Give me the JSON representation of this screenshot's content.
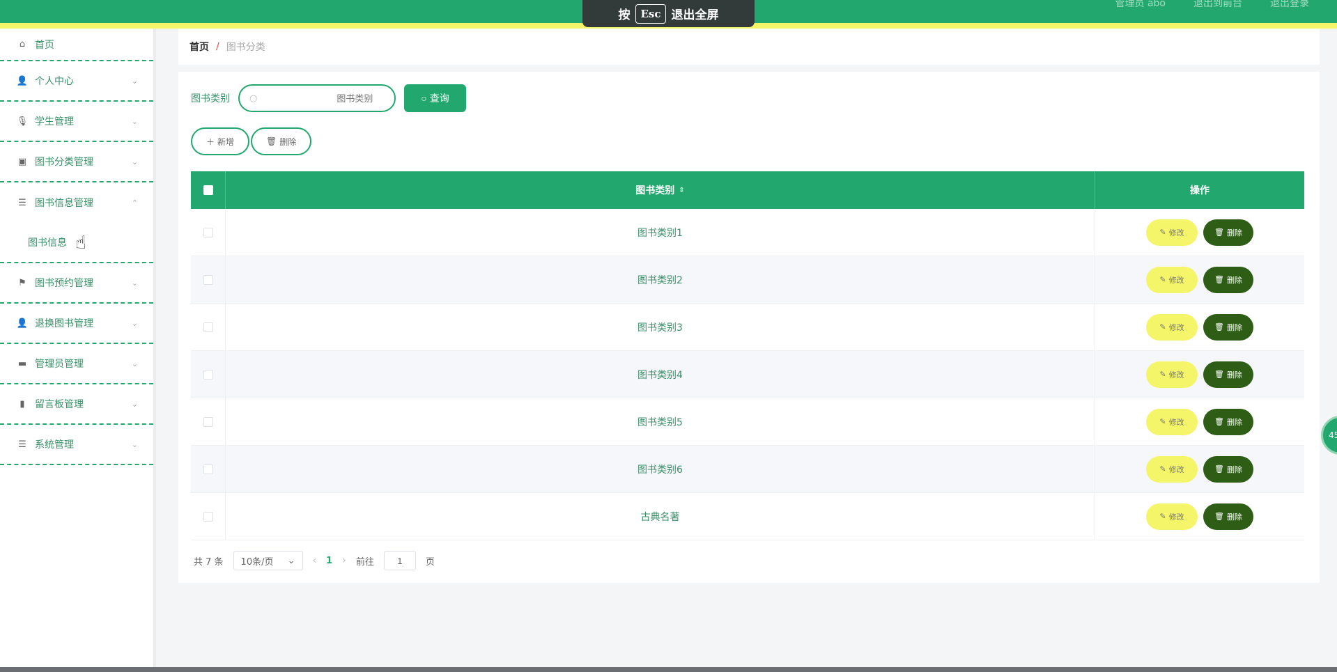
{
  "topbar": {
    "links": [
      "管理员 abo",
      "退出到前台",
      "退出登录"
    ],
    "esc_tip": {
      "prefix": "按",
      "key": "Esc",
      "suffix": "退出全屏"
    }
  },
  "sidebar": {
    "items": [
      {
        "label": "首页",
        "icon": "home-icon",
        "glyph": "⌂",
        "expandable": false
      },
      {
        "label": "个人中心",
        "icon": "user-icon",
        "glyph": "👤",
        "expandable": true
      },
      {
        "label": "学生管理",
        "icon": "microphone-icon",
        "glyph": "🎙",
        "expandable": true
      },
      {
        "label": "图书分类管理",
        "icon": "chart-square-icon",
        "glyph": "▣",
        "expandable": true
      },
      {
        "label": "图书信息管理",
        "icon": "list-icon",
        "glyph": "☰",
        "expandable": true,
        "expanded": true
      },
      {
        "label": "图书预约管理",
        "icon": "flag-icon",
        "glyph": "⚑",
        "expandable": true
      },
      {
        "label": "退换图书管理",
        "icon": "person-icon",
        "glyph": "👤",
        "expandable": true
      },
      {
        "label": "管理员管理",
        "icon": "monitor-icon",
        "glyph": "▬",
        "expandable": true
      },
      {
        "label": "留言板管理",
        "icon": "bar-chart-icon",
        "glyph": "▮",
        "expandable": true
      },
      {
        "label": "系统管理",
        "icon": "list-icon",
        "glyph": "☰",
        "expandable": true
      }
    ],
    "submenu": {
      "label": "图书信息"
    }
  },
  "breadcrumb": {
    "home": "首页",
    "separator": "/",
    "current": "图书分类"
  },
  "search": {
    "label": "图书类别",
    "placeholder": "图书类别",
    "button": "查询"
  },
  "actions": {
    "add": "新增",
    "delete": "删除"
  },
  "table": {
    "headers": {
      "name": "图书类别",
      "ops": "操作"
    },
    "rows": [
      {
        "name": "图书类别1"
      },
      {
        "name": "图书类别2"
      },
      {
        "name": "图书类别3"
      },
      {
        "name": "图书类别4"
      },
      {
        "name": "图书类别5"
      },
      {
        "name": "图书类别6"
      },
      {
        "name": "古典名著"
      }
    ],
    "edit_label": "修改",
    "delete_label": "删除"
  },
  "pagination": {
    "total": "共 7 条",
    "page_size": "10条/页",
    "current_page": "1",
    "goto_prefix": "前往",
    "goto_value": "1",
    "goto_suffix": "页"
  },
  "float_button": {
    "label": "45"
  },
  "colors": {
    "primary": "#22a86e",
    "accent_yellow": "#f5f56a",
    "danger_dark": "#2e5e16"
  }
}
